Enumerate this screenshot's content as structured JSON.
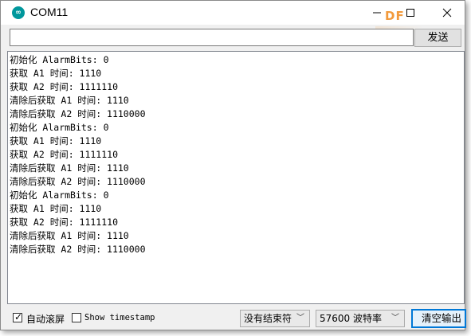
{
  "window": {
    "title": "COM11",
    "icon": "arduino-logo-icon",
    "minimize_icon": "minimize-icon",
    "maximize_icon": "maximize-icon",
    "close_icon": "close-icon"
  },
  "watermark": {
    "text": "DF"
  },
  "send": {
    "input_value": "",
    "button_label": "发送"
  },
  "output": {
    "lines": [
      "初始化 AlarmBits: 0",
      "获取 A1 时间: 1110",
      "获取 A2 时间: 1111110",
      "清除后获取 A1 时间: 1110",
      "清除后获取 A2 时间: 1110000",
      "初始化 AlarmBits: 0",
      "获取 A1 时间: 1110",
      "获取 A2 时间: 1111110",
      "清除后获取 A1 时间: 1110",
      "清除后获取 A2 时间: 1110000",
      "初始化 AlarmBits: 0",
      "获取 A1 时间: 1110",
      "获取 A2 时间: 1111110",
      "清除后获取 A1 时间: 1110",
      "清除后获取 A2 时间: 1110000"
    ]
  },
  "bottom": {
    "autoscroll": {
      "label": "自动滚屏",
      "checked": true
    },
    "timestamp": {
      "label": "Show timestamp",
      "checked": false
    },
    "line_ending": {
      "selected": "没有结束符",
      "icon": "chevron-down-icon"
    },
    "baud_rate": {
      "selected": "57600 波特率",
      "icon": "chevron-down-icon"
    },
    "clear_button_label": "清空输出"
  },
  "colors": {
    "accent_focus": "#0078d7",
    "app_icon": "#00979c",
    "watermark": "#f29a3c"
  }
}
